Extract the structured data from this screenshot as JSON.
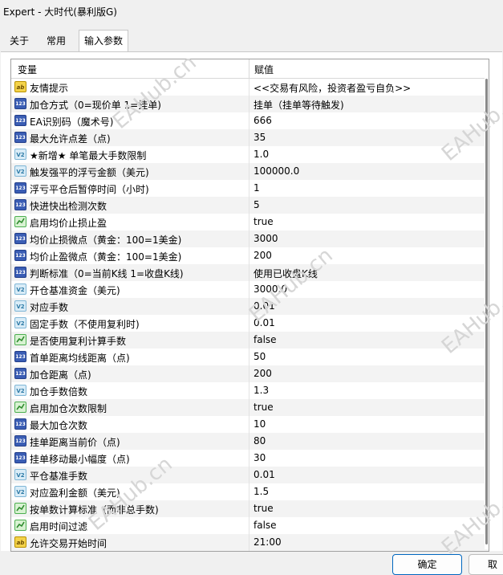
{
  "window": {
    "title": "Expert - 大时代(暴利版G)"
  },
  "tabs": [
    {
      "label": "关于"
    },
    {
      "label": "常用"
    },
    {
      "label": "输入参数"
    }
  ],
  "table": {
    "headers": {
      "variable": "变量",
      "value": "赋值"
    },
    "rows": [
      {
        "icon": "string-icon",
        "name": "友情提示",
        "value": "<<交易有风险，投资者盈亏自负>>"
      },
      {
        "icon": "integer-icon",
        "name": "加仓方式（0=现价单 1=挂单)",
        "value": "挂单（挂单等待触发)"
      },
      {
        "icon": "integer-icon",
        "name": "EA识别码（魔术号)",
        "value": "666"
      },
      {
        "icon": "integer-icon",
        "name": "最大允许点差（点)",
        "value": "35"
      },
      {
        "icon": "double-icon",
        "name": "★新增★ 单笔最大手数限制",
        "value": "1.0"
      },
      {
        "icon": "double-icon",
        "name": "触发强平的浮亏金额（美元)",
        "value": "100000.0"
      },
      {
        "icon": "integer-icon",
        "name": "浮亏平仓后暂停时间（小时)",
        "value": "1"
      },
      {
        "icon": "integer-icon",
        "name": "快进快出检测次数",
        "value": "5"
      },
      {
        "icon": "bool-icon",
        "name": "启用均价止损止盈",
        "value": "true"
      },
      {
        "icon": "integer-icon",
        "name": "均价止损微点（黄金：100=1美金)",
        "value": "3000"
      },
      {
        "icon": "integer-icon",
        "name": "均价止盈微点（黄金：100=1美金)",
        "value": "200"
      },
      {
        "icon": "integer-icon",
        "name": "判断标准（0=当前K线 1=收盘K线)",
        "value": "使用已收盘K线"
      },
      {
        "icon": "double-icon",
        "name": "开仓基准资金（美元)",
        "value": "3000.0"
      },
      {
        "icon": "double-icon",
        "name": "对应手数",
        "value": "0.01"
      },
      {
        "icon": "double-icon",
        "name": "固定手数（不使用复利时)",
        "value": "0.01"
      },
      {
        "icon": "bool-icon",
        "name": "是否使用复利计算手数",
        "value": "false"
      },
      {
        "icon": "integer-icon",
        "name": "首单距离均线距离（点)",
        "value": "50"
      },
      {
        "icon": "integer-icon",
        "name": "加仓距离（点)",
        "value": "200"
      },
      {
        "icon": "double-icon",
        "name": "加仓手数倍数",
        "value": "1.3"
      },
      {
        "icon": "bool-icon",
        "name": "启用加仓次数限制",
        "value": "true"
      },
      {
        "icon": "integer-icon",
        "name": "最大加仓次数",
        "value": "10"
      },
      {
        "icon": "integer-icon",
        "name": "挂单距离当前价（点)",
        "value": "80"
      },
      {
        "icon": "integer-icon",
        "name": "挂单移动最小幅度（点)",
        "value": "30"
      },
      {
        "icon": "double-icon",
        "name": "平仓基准手数",
        "value": "0.01"
      },
      {
        "icon": "double-icon",
        "name": "对应盈利金额（美元)",
        "value": "1.5"
      },
      {
        "icon": "bool-icon",
        "name": "按单数计算标准（而非总手数)",
        "value": "true"
      },
      {
        "icon": "bool-icon",
        "name": "启用时间过滤",
        "value": "false"
      },
      {
        "icon": "string-icon",
        "name": "允许交易开始时间",
        "value": "21:00"
      }
    ]
  },
  "icon_glyphs": {
    "integer": "123",
    "string": "ab",
    "double": "V2"
  },
  "buttons": {
    "ok": "确定",
    "cancel": "取"
  },
  "watermarks": [
    "EAHub.cn",
    "EAHub.cn",
    "EAHub.cn",
    "EAHub.cn",
    "EAHub.cn",
    "EAHub.cn"
  ]
}
